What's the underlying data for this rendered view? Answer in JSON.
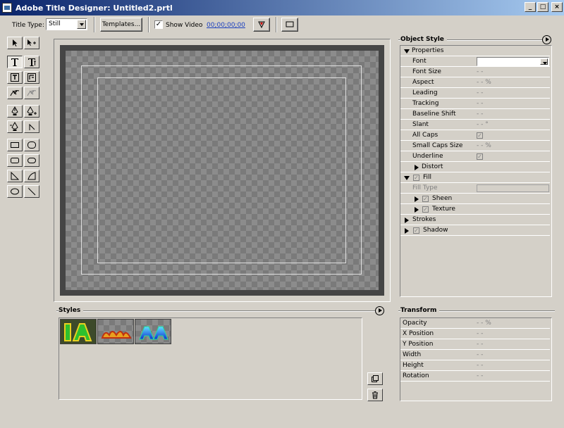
{
  "window": {
    "title": "Adobe Title Designer: Untitled2.prtl",
    "minimize": "_",
    "maximize": "□",
    "close": "×"
  },
  "toolbar": {
    "title_type_label": "Title Type:",
    "title_type_value": "Still",
    "templates_label": "Templates...",
    "show_video_label": "Show Video",
    "show_video_checked": "✓",
    "timecode": "00;00;00;00"
  },
  "tools": [
    "selection-tool",
    "rotation-tool",
    "type-tool",
    "vertical-type-tool",
    "area-type-tool",
    "vertical-area-type-tool",
    "path-type-tool",
    "vertical-path-type-tool",
    "pen-tool",
    "add-anchor-point-tool",
    "delete-anchor-point-tool",
    "convert-anchor-point-tool",
    "rectangle-tool",
    "rounded-corner-rectangle-tool",
    "clipped-corner-rectangle-tool",
    "rounded-rectangle-tool",
    "wedge-tool",
    "arc-tool",
    "ellipse-tool",
    "line-tool"
  ],
  "object_style": {
    "title": "Object Style",
    "rows": [
      {
        "label": "Properties",
        "value": ""
      },
      {
        "label": "Font",
        "value": ""
      },
      {
        "label": "Font Size",
        "value": "- -"
      },
      {
        "label": "Aspect",
        "value": "- - %"
      },
      {
        "label": "Leading",
        "value": "- -"
      },
      {
        "label": "Tracking",
        "value": "- -"
      },
      {
        "label": "Baseline Shift",
        "value": "- -"
      },
      {
        "label": "Slant",
        "value": "- - °"
      },
      {
        "label": "All Caps",
        "value": ""
      },
      {
        "label": "Small Caps Size",
        "value": "- - %"
      },
      {
        "label": "Underline",
        "value": ""
      },
      {
        "label": "Distort",
        "value": ""
      },
      {
        "label": "Fill",
        "value": ""
      },
      {
        "label": "Fill Type",
        "value": ""
      },
      {
        "label": "Sheen",
        "value": ""
      },
      {
        "label": "Texture",
        "value": ""
      },
      {
        "label": "Strokes",
        "value": ""
      },
      {
        "label": "Shadow",
        "value": ""
      }
    ],
    "check_mark": "✓"
  },
  "styles": {
    "title": "Styles"
  },
  "transform": {
    "title": "Transform",
    "rows": [
      {
        "label": "Opacity",
        "value": "- - %"
      },
      {
        "label": "X Position",
        "value": "- -"
      },
      {
        "label": "Y Position",
        "value": "- -"
      },
      {
        "label": "Width",
        "value": "- -"
      },
      {
        "label": "Height",
        "value": "- -"
      },
      {
        "label": "Rotation",
        "value": "- -"
      }
    ]
  }
}
